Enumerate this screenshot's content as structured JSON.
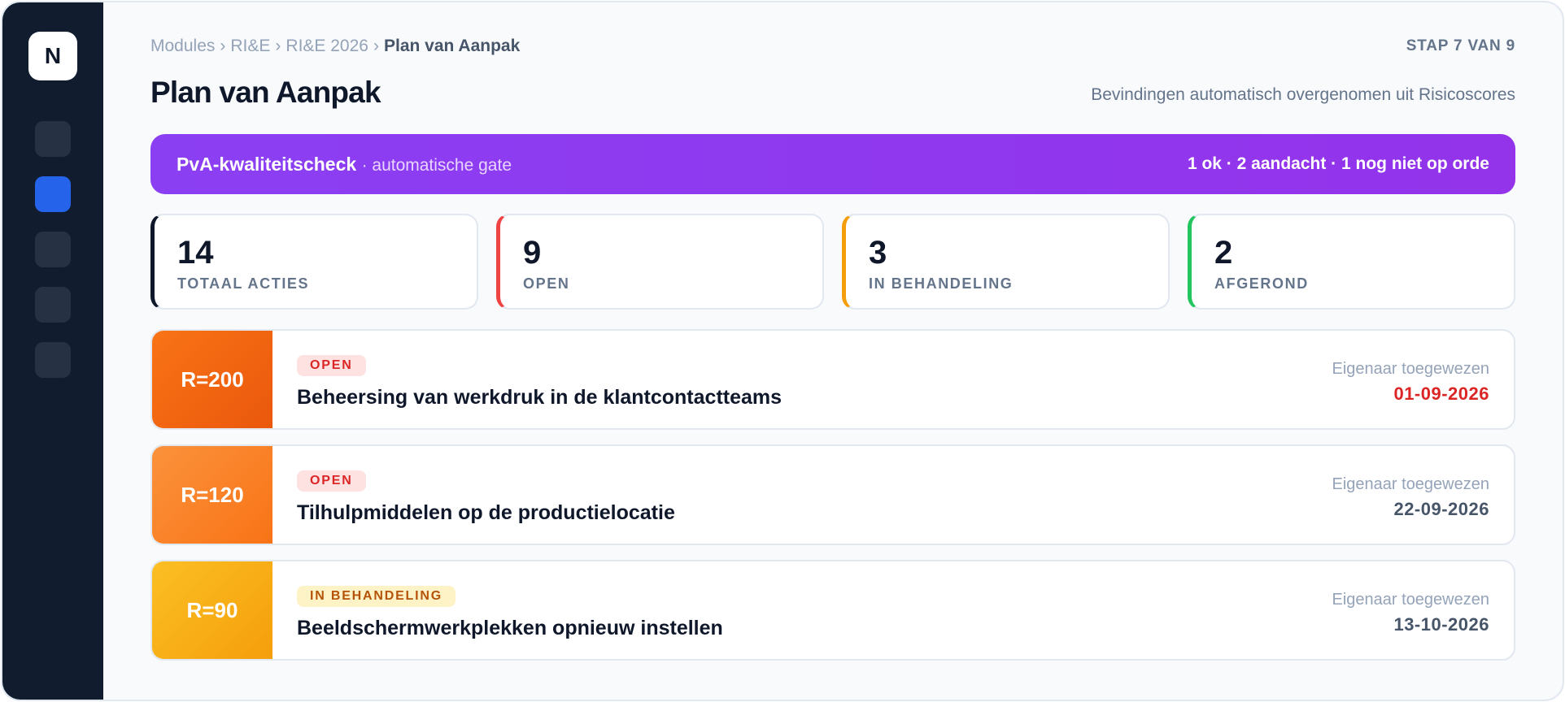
{
  "app": {
    "logo_letter": "N"
  },
  "sidebar": {
    "items": [
      {
        "name": "nav-item-1",
        "active": false
      },
      {
        "name": "nav-item-2",
        "active": true
      },
      {
        "name": "nav-item-3",
        "active": false
      },
      {
        "name": "nav-item-4",
        "active": false
      },
      {
        "name": "nav-item-5",
        "active": false
      }
    ]
  },
  "breadcrumb": {
    "items": [
      "Modules",
      "RI&E",
      "RI&E 2026"
    ],
    "current": "Plan van Aanpak",
    "separator": "›"
  },
  "header": {
    "step": "STAP 7 VAN 9",
    "title": "Plan van Aanpak",
    "subtitle": "Bevindingen automatisch overgenomen uit Risicoscores"
  },
  "gate": {
    "title": "PvA-kwaliteitscheck",
    "subtitle": "· automatische gate",
    "summary": "1 ok · 2 aandacht · 1 nog niet op orde",
    "colors": {
      "start": "#8b3ff3",
      "end": "#9333ea"
    }
  },
  "stats": [
    {
      "value": "14",
      "label": "TOTAAL ACTIES",
      "color": "#0f172a"
    },
    {
      "value": "9",
      "label": "OPEN",
      "color": "#ef4444"
    },
    {
      "value": "3",
      "label": "IN BEHANDELING",
      "color": "#f59e0b"
    },
    {
      "value": "2",
      "label": "AFGEROND",
      "color": "#22c55e"
    }
  ],
  "actions": [
    {
      "risk": "R=200",
      "risk_colors": [
        "#f97316",
        "#ea580c"
      ],
      "status": "OPEN",
      "status_type": "open",
      "title": "Beheersing van werkdruk in de klantcontactteams",
      "owner": "Eigenaar toegewezen",
      "due": "01-09-2026",
      "overdue": true
    },
    {
      "risk": "R=120",
      "risk_colors": [
        "#fb923c",
        "#f97316"
      ],
      "status": "OPEN",
      "status_type": "open",
      "title": "Tilhulpmiddelen op de productielocatie",
      "owner": "Eigenaar toegewezen",
      "due": "22-09-2026",
      "overdue": false
    },
    {
      "risk": "R=90",
      "risk_colors": [
        "#fbbf24",
        "#f59e0b"
      ],
      "status": "IN BEHANDELING",
      "status_type": "progress",
      "title": "Beeldschermwerkplekken opnieuw instellen",
      "owner": "Eigenaar toegewezen",
      "due": "13-10-2026",
      "overdue": false
    }
  ]
}
